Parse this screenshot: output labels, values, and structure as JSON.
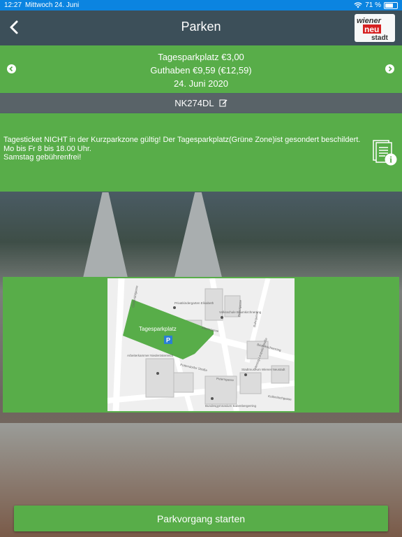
{
  "status_bar": {
    "time": "12:27",
    "date": "Mittwoch 24. Juni",
    "battery": "71 %"
  },
  "header": {
    "title": "Parken",
    "logo_text": [
      "wiener",
      "neu",
      "stadt"
    ]
  },
  "zone": {
    "line1": "Tagesparkplatz €3,00",
    "line2": "Guthaben €9,59 (€12,59)",
    "line3": "24. Juni 2020"
  },
  "plate": {
    "number": "NK274DL"
  },
  "info": {
    "line1": "Tagesticket NICHT in der Kurzparkzone gültig! Der Tagesparkplatz(Grüne Zone)ist gesondert beschildert.",
    "line2": "Mo bis Fr 8 bis 18.00 Uhr.",
    "line3": "Samstag gebührenfrei!"
  },
  "map": {
    "area_label": "Tagesparkplatz",
    "parking_symbol": "P",
    "streets": [
      "Gröhmühlgasse",
      "Mayergasse",
      "Bahngasse",
      "Reyergasse",
      "Baumkirchnerring",
      "Herzog-Leopold-Straße",
      "Pottendorfer Straße",
      "Petersgasse",
      "Kollonitschgasse"
    ],
    "pois": [
      "Privatkindergarten Elisabeth",
      "Volksschule Baumkirchnerring",
      "Stadtmuseum Wiener Neustadt",
      "Arbeiterkammer Niederösterreich",
      "Bundesgymnasium Babenbergerring"
    ]
  },
  "actions": {
    "start_label": "Parkvorgang starten"
  },
  "colors": {
    "status_bar": "#0b84e0",
    "nav_bar": "#3c4f59",
    "accent_green": "#58ad49",
    "white": "#ffffff"
  },
  "icons": [
    "wifi-icon",
    "battery-icon",
    "back-chevron-icon",
    "prev-arrow-icon",
    "next-arrow-icon",
    "edit-icon",
    "info-document-icon",
    "parking-icon"
  ]
}
